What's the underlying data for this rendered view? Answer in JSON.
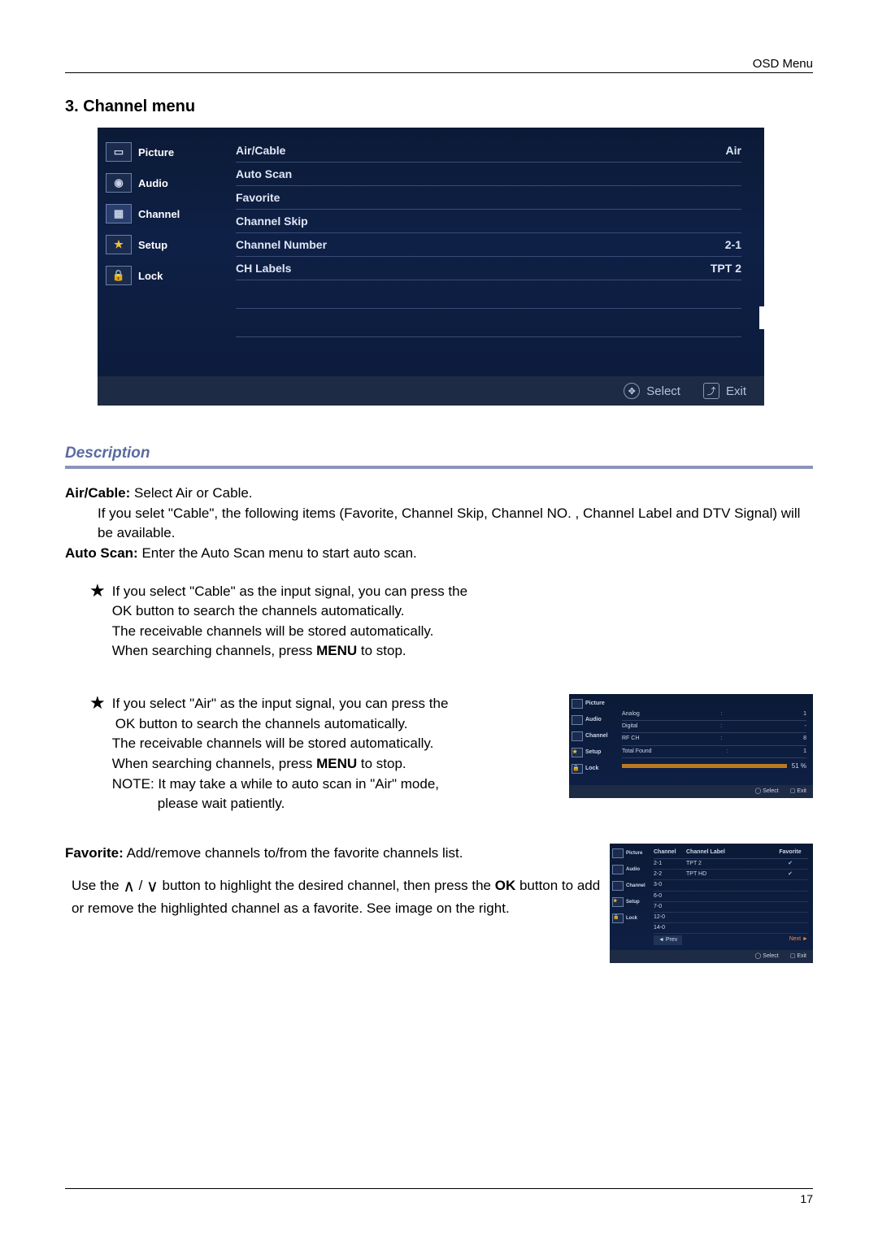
{
  "header": {
    "right": "OSD Menu"
  },
  "section_title": "3. Channel menu",
  "osd": {
    "sidebar": [
      {
        "label": "Picture",
        "icon": "picture-icon"
      },
      {
        "label": "Audio",
        "icon": "audio-icon"
      },
      {
        "label": "Channel",
        "icon": "channel-icon",
        "active": true
      },
      {
        "label": "Setup",
        "icon": "setup-icon"
      },
      {
        "label": "Lock",
        "icon": "lock-icon"
      }
    ],
    "rows": [
      {
        "label": "Air/Cable",
        "value": "Air"
      },
      {
        "label": "Auto Scan",
        "value": ""
      },
      {
        "label": "Favorite",
        "value": ""
      },
      {
        "label": "Channel Skip",
        "value": ""
      },
      {
        "label": "Channel Number",
        "value": "2-1"
      },
      {
        "label": "CH Labels",
        "value": "TPT 2"
      }
    ],
    "footer": {
      "select": "Select",
      "exit": "Exit"
    }
  },
  "description": {
    "heading": "Description",
    "aircable_label": "Air/Cable:",
    "aircable_text": " Select  Air or Cable.",
    "aircable_note": "If you selet \"Cable\", the following items (Favorite, Channel Skip, Channel NO. , Channel Label and DTV Signal) will be available.",
    "autoscan_label": "Auto Scan:",
    "autoscan_text": " Enter the Auto Scan menu to start auto scan.",
    "star1": {
      "l1": "If you select \"Cable\" as the input signal,  you can press the",
      "l2": "OK button to search the channels automatically.",
      "l3": "The receivable channels will be stored automatically.",
      "l4a": "When searching channels, press ",
      "l4b": "MENU",
      "l4c": " to stop."
    },
    "star2": {
      "l1": "If you select \"Air\" as the input signal, you can press the",
      "l2": "OK button to search the channels automatically.",
      "l3": "The receivable channels will be stored automatically.",
      "l4a": "When searching channels, press ",
      "l4b": "MENU",
      "l4c": " to stop.",
      "l5": "NOTE: It may take a while to auto scan in \"Air\" mode,",
      "l6": "please wait patiently."
    },
    "favorite_label": "Favorite:",
    "favorite_text": " Add/remove channels to/from the favorite channels list.",
    "favorite_para_a": "Use  the ",
    "favorite_para_b": " button to highlight the desired channel, then press the ",
    "favorite_para_c": "OK",
    "favorite_para_d": "  button to add or remove the highlighted channel as a favorite. See image on the right."
  },
  "mini_scan": {
    "rows": [
      {
        "label": "Analog",
        "sep": ":",
        "value": "1"
      },
      {
        "label": "Digital",
        "sep": ":",
        "value": "-"
      },
      {
        "label": "RF CH",
        "sep": ":",
        "value": "8"
      },
      {
        "label": "Total Found",
        "sep": ":",
        "value": "1"
      }
    ],
    "progress": "51 %",
    "footer": {
      "select": "Select",
      "exit": "Exit"
    }
  },
  "mini_fav": {
    "head": {
      "c1": "Channel",
      "c2": "Channel Label",
      "c3": "Favorite"
    },
    "rows": [
      {
        "ch": "2-1",
        "label": "TPT 2",
        "fav": "✔"
      },
      {
        "ch": "2-2",
        "label": "TPT HD",
        "fav": "✔"
      },
      {
        "ch": "3-0",
        "label": "",
        "fav": ""
      },
      {
        "ch": "6-0",
        "label": "",
        "fav": ""
      },
      {
        "ch": "7-0",
        "label": "",
        "fav": ""
      },
      {
        "ch": "12-0",
        "label": "",
        "fav": ""
      },
      {
        "ch": "14-0",
        "label": "",
        "fav": ""
      }
    ],
    "nav": {
      "prev": "◄  Prev",
      "next": "Next  ►"
    },
    "footer": {
      "select": "Select",
      "exit": "Exit"
    }
  },
  "page_number": "17"
}
